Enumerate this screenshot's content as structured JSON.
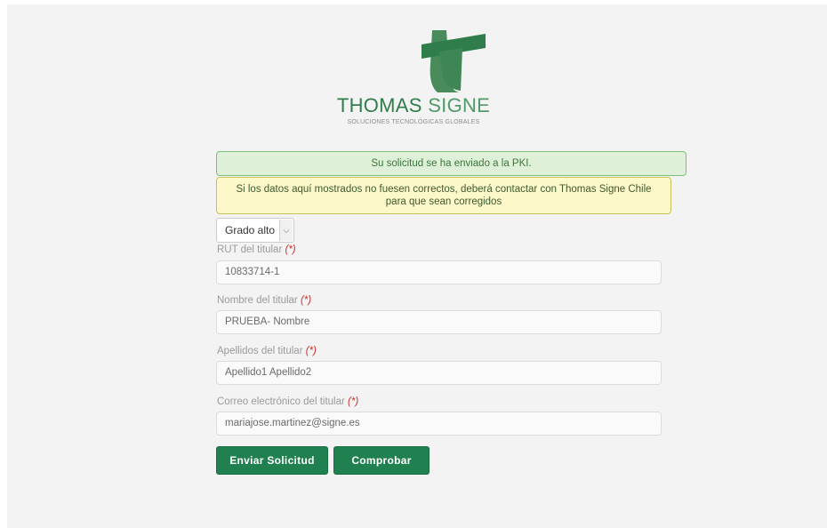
{
  "brand": {
    "name_bold": "THOMAS",
    "name_light": "SIGNE",
    "tagline": "SOLUCIONES TECNOLÓGICAS GLOBALES"
  },
  "alerts": {
    "success": "Su solicitud se ha enviado a la PKI.",
    "warning": "Si los datos aquí mostrados no fuesen correctos, deberá contactar con Thomas Signe Chile para que sean corregidos"
  },
  "form": {
    "grade_select": {
      "selected": "Grado alto"
    },
    "required_marker": "(*)",
    "fields": [
      {
        "label": "RUT del titular",
        "value": "10833714-1"
      },
      {
        "label": "Nombre del titular",
        "value": "PRUEBA- Nombre"
      },
      {
        "label": "Apellidos del titular",
        "value": "Apellido1 Apellido2"
      },
      {
        "label": "Correo electrónico del titular",
        "value": "mariajose.martinez@signe.es"
      }
    ]
  },
  "buttons": {
    "submit": "Enviar Solicitud",
    "check": "Comprobar"
  },
  "colors": {
    "brand_green": "#2e7d4a",
    "button_green": "#218050",
    "success_bg": "#dff0d8",
    "warning_bg": "#fcf8c9",
    "required_red": "#c9302c"
  }
}
